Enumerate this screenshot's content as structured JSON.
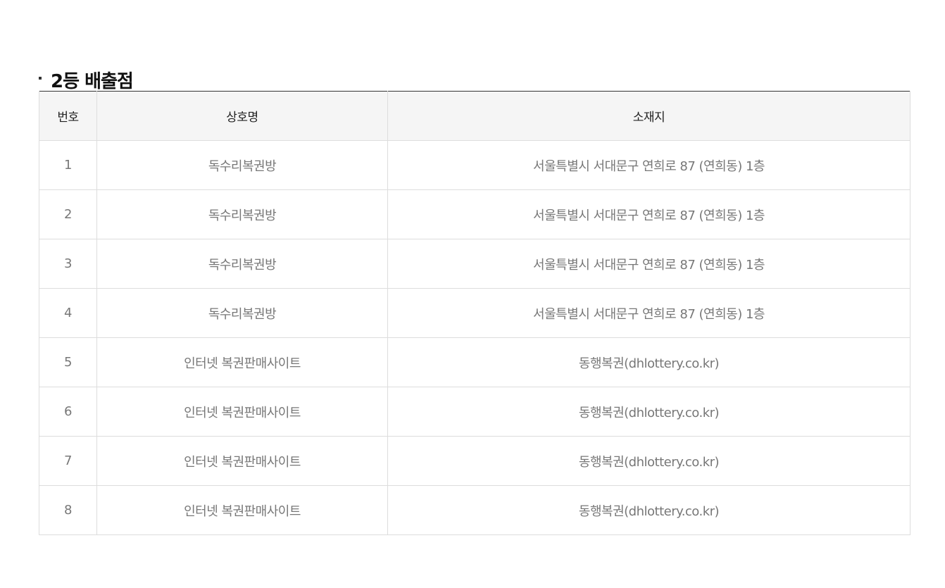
{
  "section": {
    "title": "2등 배출점"
  },
  "table": {
    "headers": {
      "no": "번호",
      "name": "상호명",
      "address": "소재지"
    },
    "rows": [
      {
        "no": "1",
        "name": "독수리복권방",
        "address": "서울특별시 서대문구 연희로 87 (연희동) 1층"
      },
      {
        "no": "2",
        "name": "독수리복권방",
        "address": "서울특별시 서대문구 연희로 87 (연희동) 1층"
      },
      {
        "no": "3",
        "name": "독수리복권방",
        "address": "서울특별시 서대문구 연희로 87 (연희동) 1층"
      },
      {
        "no": "4",
        "name": "독수리복권방",
        "address": "서울특별시 서대문구 연희로 87 (연희동) 1층"
      },
      {
        "no": "5",
        "name": "인터넷 복권판매사이트",
        "address": "동행복권(dhlottery.co.kr)"
      },
      {
        "no": "6",
        "name": "인터넷 복권판매사이트",
        "address": "동행복권(dhlottery.co.kr)"
      },
      {
        "no": "7",
        "name": "인터넷 복권판매사이트",
        "address": "동행복권(dhlottery.co.kr)"
      },
      {
        "no": "8",
        "name": "인터넷 복권판매사이트",
        "address": "동행복권(dhlottery.co.kr)"
      }
    ]
  }
}
